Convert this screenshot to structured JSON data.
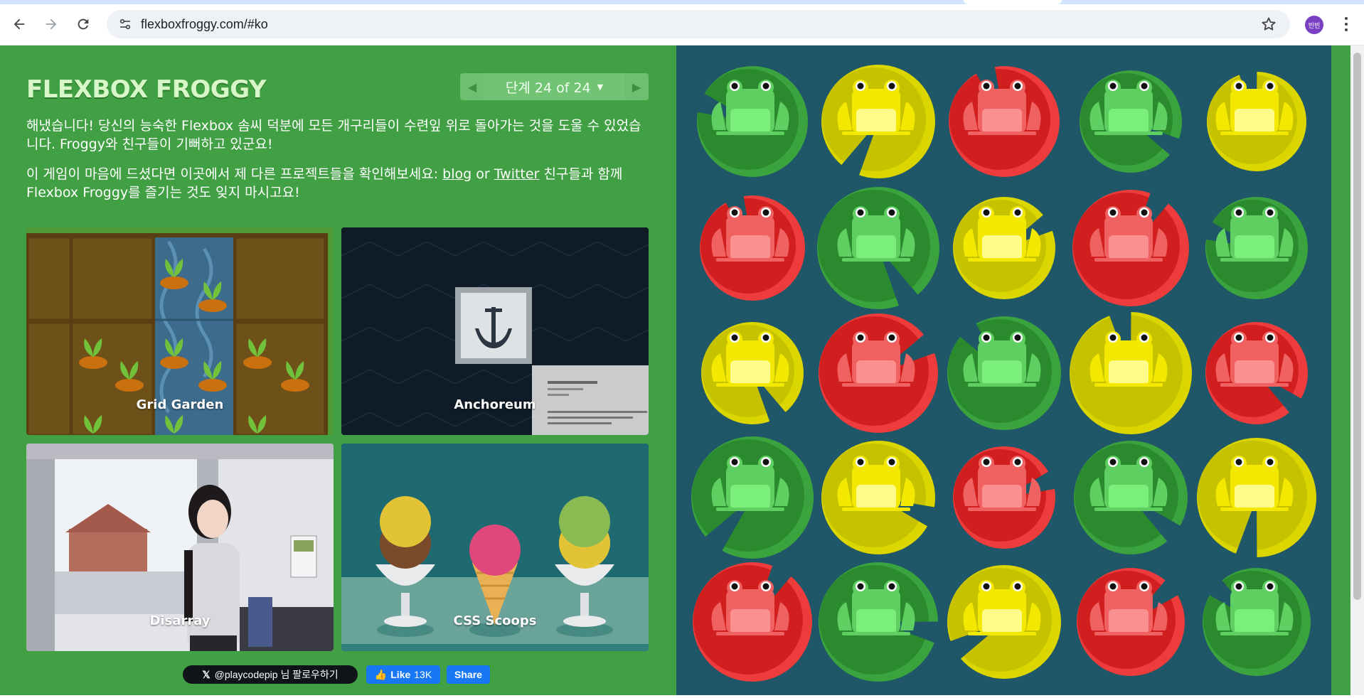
{
  "browser": {
    "url": "flexboxfroggy.com/#ko",
    "profile_initials": "빈빈"
  },
  "header": {
    "logo": "FLEXBOX FROGGY",
    "level_indicator": "단계 24 of 24"
  },
  "content": {
    "win_message": "해냈습니다! 당신의 능숙한 Flexbox 솜씨 덕분에 모든 개구리들이 수련잎 위로 돌아가는 것을 도울 수 있었습니다. Froggy와 친구들이 기뻐하고 있군요!",
    "promo_before": "이 게임이 마음에 드셨다면 이곳에서 제 다른 프로젝트들을 확인해보세요: ",
    "blog_link": "blog",
    "or_text": " or ",
    "twitter_link": "Twitter",
    "promo_after": " 친구들과 함께 Flexbox Froggy를 즐기는 것도 잊지 마시고요!"
  },
  "projects": [
    {
      "title": "Grid Garden"
    },
    {
      "title": "Anchoreum"
    },
    {
      "title": "Disarray"
    },
    {
      "title": "CSS Scoops"
    }
  ],
  "social": {
    "x_follow": "@playcodepip 님 팔로우하기",
    "like_label": "Like",
    "like_count": "13K",
    "share_label": "Share"
  },
  "pond": {
    "rows": [
      [
        "green",
        "yellow",
        "red",
        "green",
        "yellow"
      ],
      [
        "red",
        "green",
        "yellow",
        "red",
        "green"
      ],
      [
        "yellow",
        "red",
        "green",
        "yellow",
        "red"
      ],
      [
        "green",
        "yellow",
        "red",
        "green",
        "yellow"
      ],
      [
        "red",
        "green",
        "yellow",
        "red",
        "green"
      ]
    ],
    "colors": {
      "green": {
        "pad": "#2b8a2d",
        "padLight": "#3aa33d",
        "frog": "#5fcf61",
        "belly": "#7af07b"
      },
      "yellow": {
        "pad": "#c7c200",
        "padLight": "#dcd600",
        "frog": "#f2e800",
        "belly": "#fffb8a"
      },
      "red": {
        "pad": "#d11f1f",
        "padLight": "#ee3b3b",
        "frog": "#f06262",
        "belly": "#fb9090"
      }
    }
  }
}
